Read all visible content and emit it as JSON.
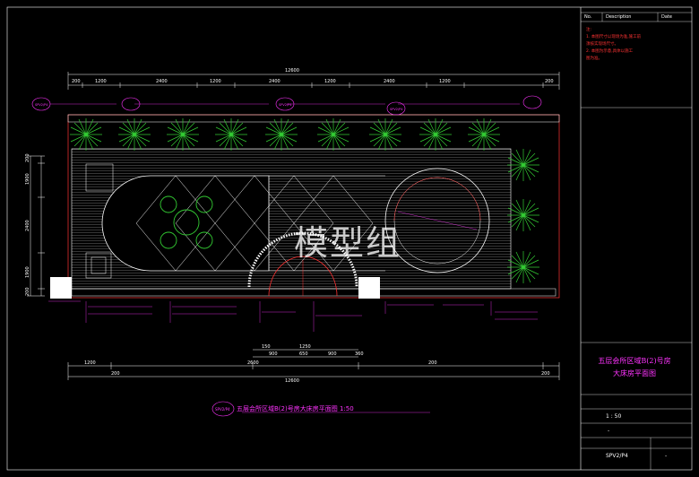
{
  "drawing": {
    "caption": "五层会所区域B(2)号房大床房平面图 1:50",
    "tag_main": "SPV2/P4",
    "labels_top": [
      "SPV2/P4",
      "SPV2/P4",
      "SPV2/P4"
    ],
    "scale_text": "1:50"
  },
  "dimensions": {
    "top_total": "12600",
    "top_row": [
      "200",
      "1200",
      "2400",
      "1200",
      "2400",
      "1200",
      "2400",
      "1200",
      "200"
    ],
    "bottom_total": "12600",
    "bottom_row": [
      "1200",
      "200",
      "2600",
      "200",
      "200"
    ],
    "bottom_mid": [
      "150",
      "1250",
      "900",
      "650",
      "900",
      "360"
    ],
    "left_col": [
      "200",
      "1900",
      "2400",
      "1900",
      "200"
    ]
  },
  "title_block": {
    "header": [
      "No.",
      "Description",
      "Date"
    ],
    "notes": [
      "注:",
      "1. 本图尺寸以现场为准,施工前",
      "   须核实现场尺寸。",
      "2. 本图为示意,具体以施工",
      "   图为准。"
    ],
    "title_line1": "五层会所区域B(2)号房",
    "title_line2": "大床房平面图",
    "scale": "1 : 50",
    "dash": "-",
    "drawing_no": "SPV2/P4",
    "sheet": "-"
  },
  "watermark": "模型组",
  "colors": {
    "background": "#000000",
    "line": "#ffffff",
    "accent": "#ff33ff",
    "note": "#ff3333",
    "plant": "#33cc33",
    "dimension": "#ffffff"
  }
}
